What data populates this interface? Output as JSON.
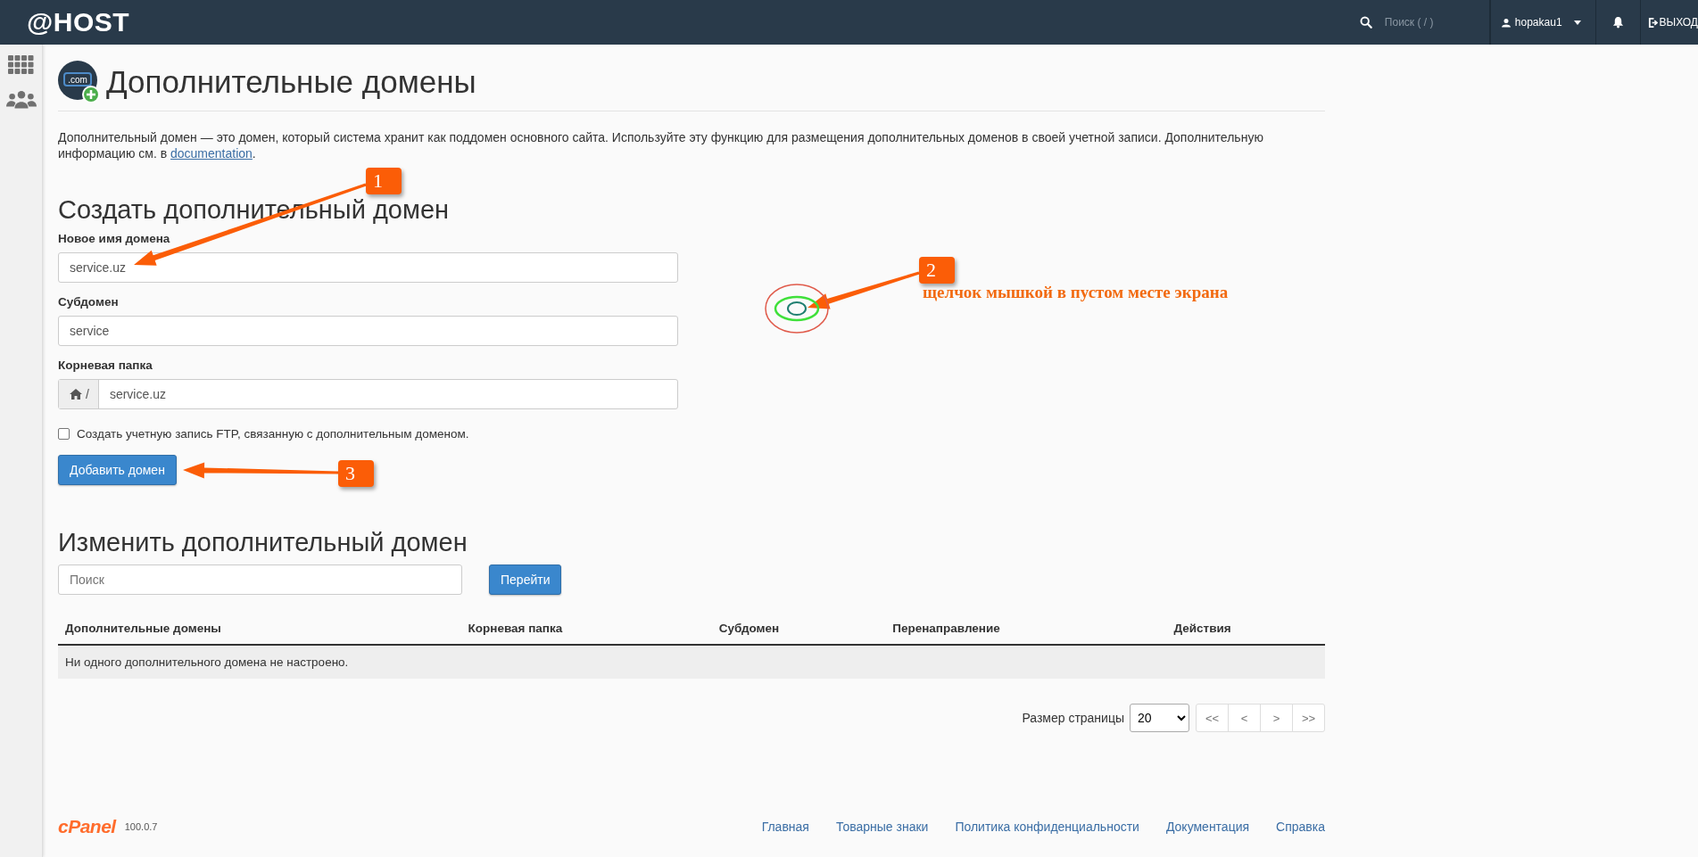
{
  "top_bar": {
    "logo": "@HOST",
    "search": {
      "placeholder": "Поиск ( / )"
    },
    "user": "hopakau1",
    "logout": "ВЫХОД"
  },
  "page": {
    "icon_text": ".com",
    "title": "Дополнительные домены",
    "description": "Дополнительный домен — это домен, который система хранит как поддомен основного сайта. Используйте эту функцию для размещения дополнительных доменов в своей учетной записи. Дополнительную информацию см. в ",
    "description_link": "documentation",
    "description_end": "."
  },
  "create_form": {
    "heading": "Создать дополнительный домен",
    "fields": [
      {
        "kind": "text",
        "label": "Новое имя домена",
        "value": "service.uz"
      },
      {
        "kind": "text",
        "label": "Субдомен",
        "value": "service"
      },
      {
        "kind": "path",
        "label": "Корневая папка",
        "prefix": "/",
        "value": "service.uz"
      }
    ],
    "ftp_checkbox": {
      "label": "Создать учетную запись FTP, связанную с дополнительным доменом.",
      "checked": false
    },
    "submit": "Добавить домен"
  },
  "manage": {
    "heading": "Изменить дополнительный домен",
    "search": {
      "placeholder": "Поиск"
    },
    "go_button": "Перейти",
    "table": {
      "columns": [
        "Дополнительные домены",
        "Корневая папка",
        "Субдомен",
        "Перенаправление",
        "Действия"
      ],
      "empty_message": "Ни одного дополнительного домена не настроено."
    },
    "pagination": {
      "label": "Размер страницы",
      "page_size": "20",
      "buttons": [
        "<<",
        "<",
        ">",
        ">>"
      ]
    }
  },
  "footer": {
    "logo": "cPanel",
    "version": "100.0.7",
    "links": [
      "Главная",
      "Товарные знаки",
      "Политика конфиденциальности",
      "Документация",
      "Справка"
    ]
  },
  "annotations": [
    {
      "number": "1"
    },
    {
      "number": "2",
      "text": "щелчок мышкой в пустом месте экрана"
    },
    {
      "number": "3"
    }
  ]
}
